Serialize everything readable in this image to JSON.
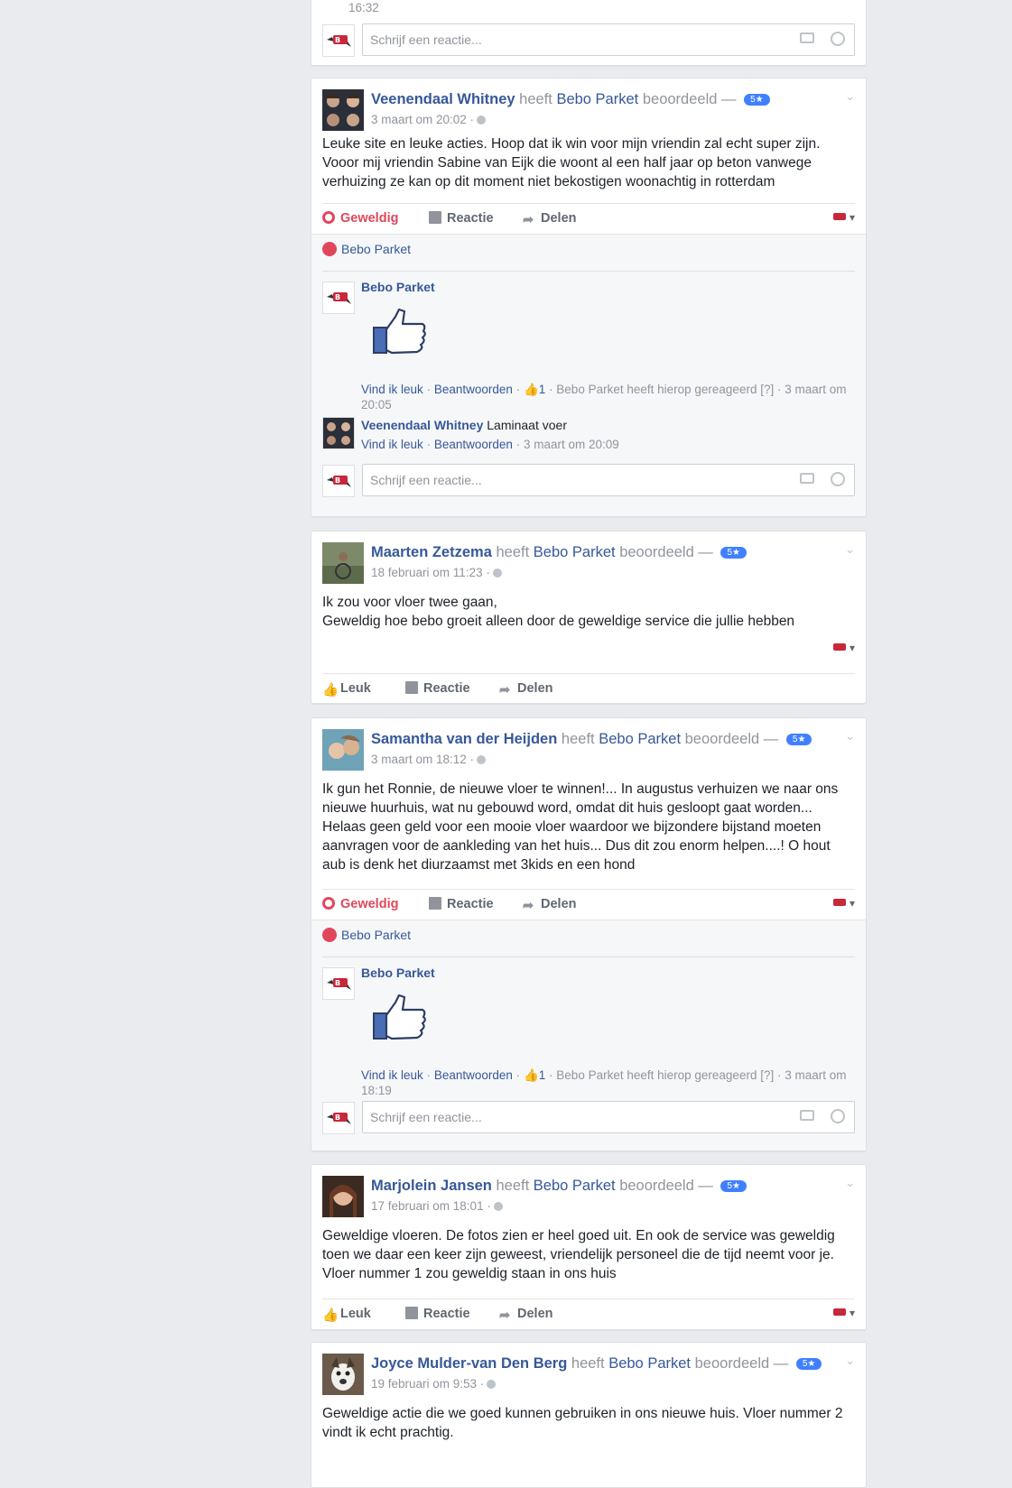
{
  "composer_placeholder": "Schrijf een reactie...",
  "colors": {
    "link": "#365899",
    "love": "#e0475c",
    "stars_badge": "#4080ff",
    "background": "#e9ebee"
  },
  "first_card": {
    "time": "16:32"
  },
  "labels": {
    "heeft": "heeft",
    "beoordeeld": "beoordeeld",
    "dash": "—",
    "geweldig": "Geweldig",
    "leuk": "Leuk",
    "reactie": "Reactie",
    "delen": "Delen",
    "vind_ik_leuk": "Vind ik leuk",
    "beantwoorden": "Beantwoorden",
    "sep": "·"
  },
  "page_name": "Bebo Parket",
  "reviews": [
    {
      "reviewer": "Veenendaal Whitney",
      "stars": "5★",
      "date": "3 maart om 20:02 ·",
      "text": "Leuke site en leuke acties. Hoop dat ik win voor mijn vriendin zal echt super zijn. Vooor mij vriendin Sabine van Eijk die woont al een half jaar op beton vanwege verhuizing ze kan op dit moment niet bekostigen woonachtig in rotterdam",
      "reacted_by": "Bebo Parket",
      "comment1": {
        "author": "Bebo Parket",
        "likes": "1",
        "meta_tail": "Bebo Parket heeft hierop gereageerd [?] · 3 maart om 20:05"
      },
      "comment2": {
        "author": "Veenendaal Whitney",
        "text": "Laminaat voer",
        "meta_tail": "3 maart om 20:09"
      }
    },
    {
      "reviewer": "Maarten Zetzema",
      "stars": "5★",
      "date": "18 februari om 11:23 ·",
      "text_line1": "Ik zou voor vloer twee gaan,",
      "text_line2": "Geweldig hoe bebo groeit alleen door de geweldige service die jullie hebben"
    },
    {
      "reviewer": "Samantha van der Heijden",
      "stars": "5★",
      "date": "3 maart om 18:12 ·",
      "text": "Ik gun het Ronnie, de nieuwe vloer te winnen!... In augustus verhuizen we naar ons nieuwe huurhuis, wat nu gebouwd word, omdat dit huis gesloopt gaat worden... Helaas geen geld voor een mooie vloer waardoor we bijzondere bijstand moeten aanvragen voor de aankleding van het huis... Dus dit zou enorm helpen....! O hout aub is denk het diurzaamst met 3kids en een hond",
      "reacted_by": "Bebo Parket",
      "comment1": {
        "author": "Bebo Parket",
        "likes": "1",
        "meta_tail": "Bebo Parket heeft hierop gereageerd [?] · 3 maart om 18:19"
      }
    },
    {
      "reviewer": "Marjolein Jansen",
      "stars": "5★",
      "date": "17 februari om 18:01 ·",
      "text": "Geweldige vloeren. De fotos zien er heel goed uit. En ook de service was geweldig toen we daar een keer zijn geweest, vriendelijk personeel die de tijd neemt voor je. Vloer nummer 1 zou geweldig staan in ons huis"
    },
    {
      "reviewer": "Joyce Mulder-van Den Berg",
      "stars": "5★",
      "date": "19 februari om 9:53 ·",
      "text": "Geweldige actie die we goed kunnen gebruiken in ons nieuwe huis. Vloer nummer 2 vindt ik echt prachtig."
    }
  ]
}
